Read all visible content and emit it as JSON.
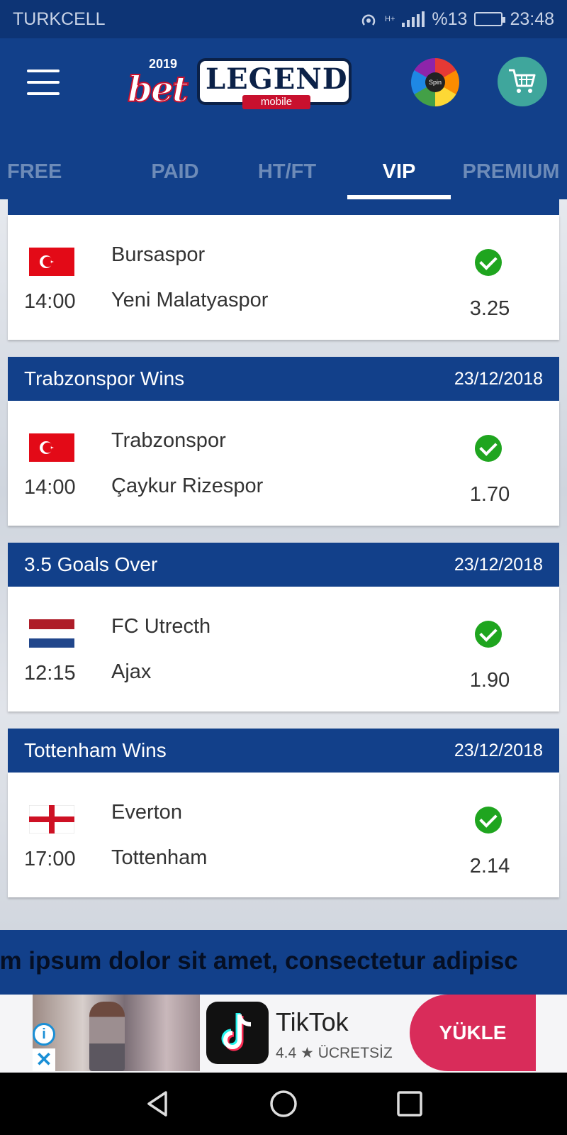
{
  "status_bar": {
    "carrier": "TURKCELL",
    "network": "H+",
    "battery": "%13",
    "time": "23:48"
  },
  "app": {
    "logo": {
      "year": "2019",
      "bet": "bet",
      "legend": "LEGEND",
      "mobile": "mobile"
    },
    "spin_label": "Spin",
    "tabs": [
      {
        "label": "FREE",
        "active": false
      },
      {
        "label": "PAID",
        "active": false
      },
      {
        "label": "HT/FT",
        "active": false
      },
      {
        "label": "VIP",
        "active": true
      },
      {
        "label": "PREMIUM",
        "active": false
      }
    ]
  },
  "cards": [
    {
      "title": "",
      "date": "",
      "time": "14:00",
      "flag": "turkey",
      "home": "Bursaspor",
      "away": "Yeni Malatyaspor",
      "odds": "3.25",
      "result": "won"
    },
    {
      "title": "Trabzonspor Wins",
      "date": "23/12/2018",
      "time": "14:00",
      "flag": "turkey",
      "home": "Trabzonspor",
      "away": "Çaykur Rizespor",
      "odds": "1.70",
      "result": "won"
    },
    {
      "title": "3.5 Goals Over",
      "date": "23/12/2018",
      "time": "12:15",
      "flag": "netherlands",
      "home": "FC Utrecth",
      "away": "Ajax",
      "odds": "1.90",
      "result": "won"
    },
    {
      "title": "Tottenham Wins",
      "date": "23/12/2018",
      "time": "17:00",
      "flag": "england",
      "home": "Everton",
      "away": "Tottenham",
      "odds": "2.14",
      "result": "won"
    }
  ],
  "ticker": {
    "text": "em ipsum dolor sit amet, consectetur adipisc"
  },
  "ad": {
    "app_name": "TikTok",
    "rating": "4.4 ★ ÜCRETSİZ",
    "button": "YÜKLE",
    "info_icon": "i",
    "close_icon": "✕"
  },
  "colors": {
    "primary": "#12408a",
    "status": "#0d3475",
    "success": "#1fa51f",
    "ad_button": "#d92c5a"
  }
}
